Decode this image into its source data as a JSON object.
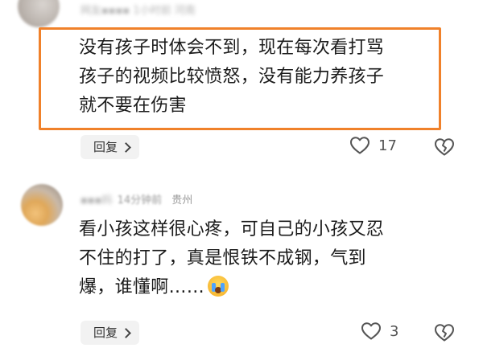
{
  "comment1": {
    "meta_blurred": "网友▪▪▪▪ 1小时前 河南",
    "text_lines": [
      "没有孩子时体会不到，现在每次看打骂",
      "孩子的视频比较愤怒，没有能力养孩子",
      "就不要在伤害"
    ],
    "reply_label": "回复",
    "like_count": "17"
  },
  "comment2": {
    "name_blurred": "▪▪▪妈",
    "time_blurred": "14分钟前",
    "location": "贵州",
    "text_lines": [
      "看小孩这样很心疼，可自己的小孩又忍",
      "不住的打了，真是恨铁不成钢，气到",
      "爆，谁懂啊……"
    ],
    "reply_label": "回复",
    "like_count": "3"
  },
  "icons": {
    "like": "heart-outline-icon",
    "dislike": "broken-heart-icon",
    "emoji": "loudly-crying-face-emoji"
  },
  "colors": {
    "highlight_border": "#f0812a",
    "reply_bg": "#f2f2f2"
  }
}
